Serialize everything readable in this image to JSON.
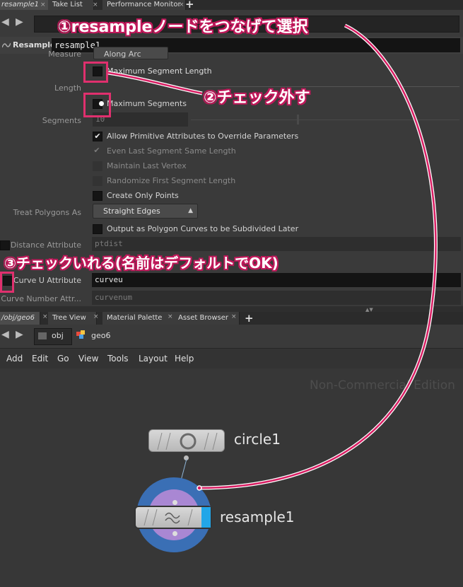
{
  "top_tabs": [
    {
      "label": "resample1",
      "active": true
    },
    {
      "label": "Take List"
    },
    {
      "label": "Performance Monitor"
    }
  ],
  "node_header": {
    "type": "Resample",
    "name": "resample1"
  },
  "params": {
    "measure_label": "Measure",
    "measure_value": "Along Arc",
    "max_seg_length": "Maximum Segment Length",
    "length_label": "Length",
    "max_segments": "Maximum Segments",
    "segments_label": "Segments",
    "segments_value": "10",
    "allow_prim": "Allow Primitive Attributes to Override Parameters",
    "even_last": "Even Last Segment Same Length",
    "maintain_last": "Maintain Last Vertex",
    "randomize_first": "Randomize First Segment Length",
    "create_only_points": "Create Only Points",
    "treat_polygons_label": "Treat Polygons As",
    "treat_polygons_value": "Straight Edges",
    "output_polygon": "Output as Polygon Curves to be Subdivided Later",
    "distance_attr_label": "Distance Attribute",
    "distance_attr_value": "ptdist",
    "curve_u_label": "Curve U Attribute",
    "curve_u_value": "curveu",
    "curve_number_label": "Curve Number Attr...",
    "curve_number_value": "curvenum"
  },
  "bottom_tabs": [
    {
      "label": "/obj/geo6",
      "active": true
    },
    {
      "label": "Tree View"
    },
    {
      "label": "Material Palette"
    },
    {
      "label": "Asset Browser"
    }
  ],
  "path": {
    "obj": "obj",
    "geo": "geo6"
  },
  "menu": [
    "Add",
    "Edit",
    "Go",
    "View",
    "Tools",
    "Layout",
    "Help"
  ],
  "watermark": "Non-Commercial Edition",
  "nodes": {
    "circle": "circle1",
    "resample": "resample1"
  },
  "annotations": {
    "a1": "①resampleノードをつなげて選択",
    "a2": "②チェック外す",
    "a3": "③チェックいれる(名前はデフォルトでOK)"
  },
  "colors": {
    "annotation": "#c0185a",
    "highlight": "#e0306e",
    "selected_node": "#3a6fb5"
  },
  "icons": {
    "plus": "+",
    "close": "×",
    "dropdown": "▴▾",
    "check": "✔"
  }
}
